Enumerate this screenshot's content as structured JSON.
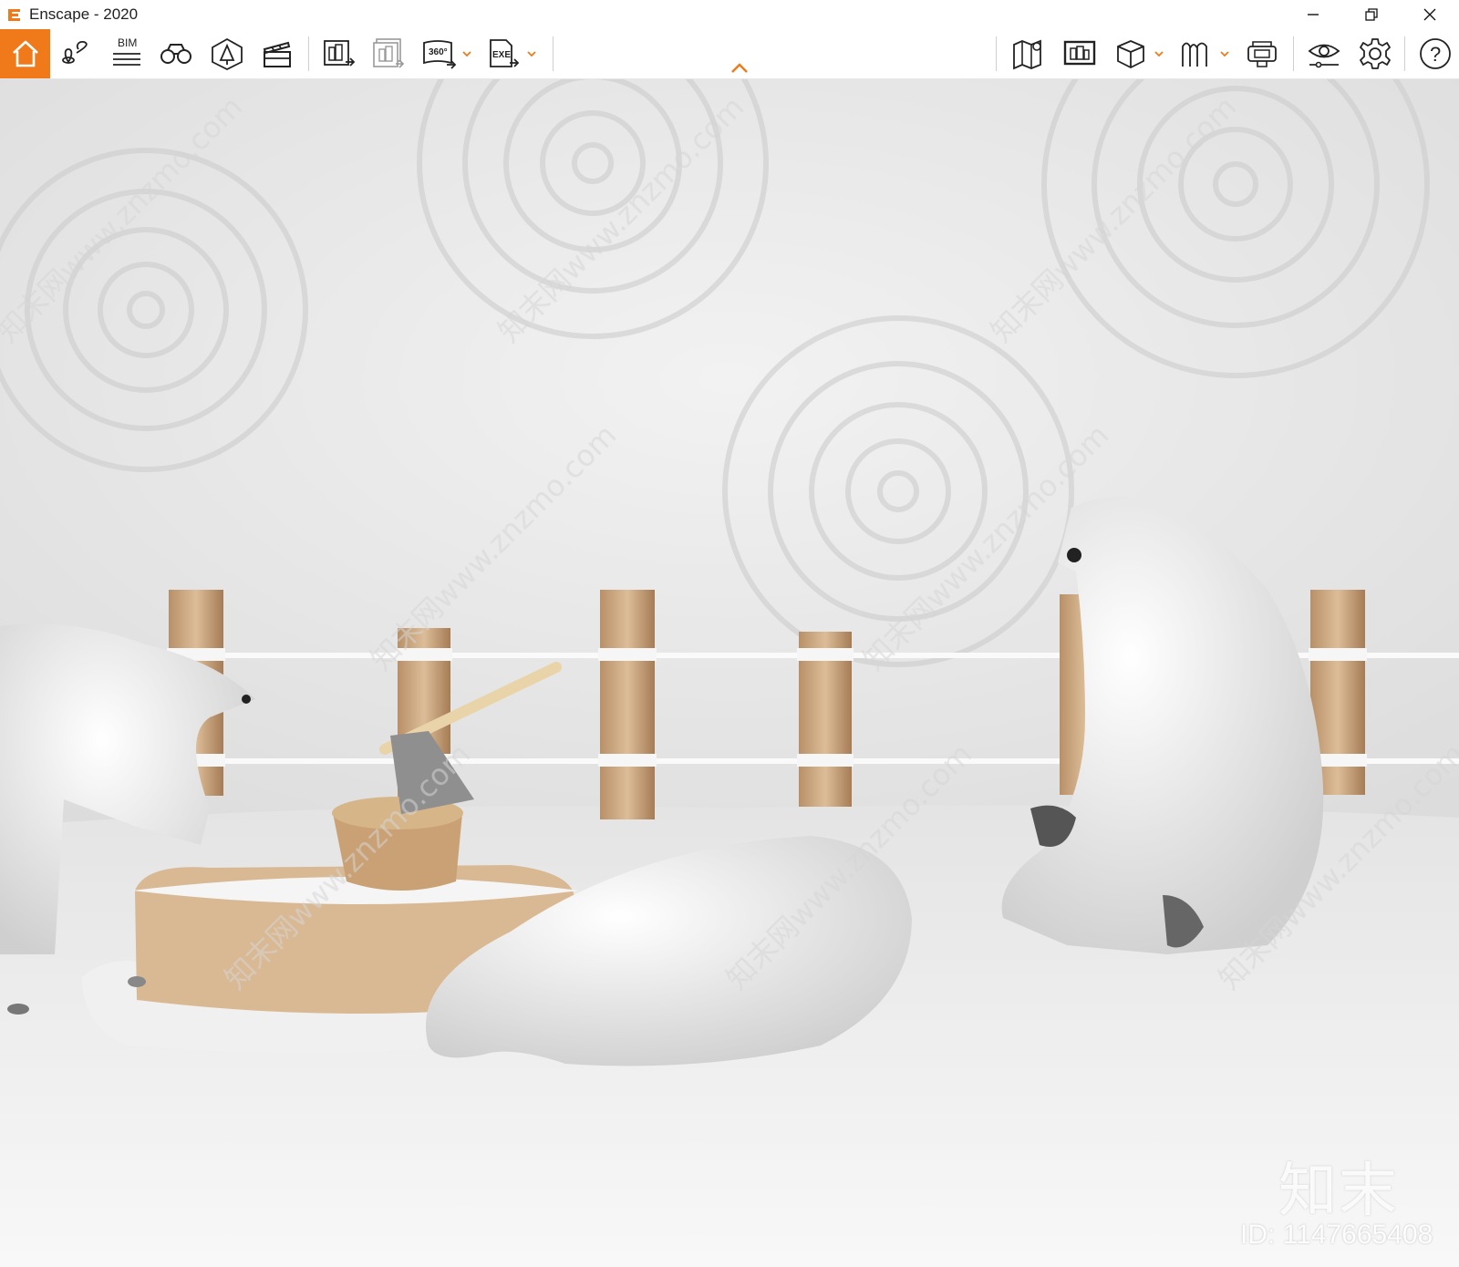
{
  "window": {
    "title": "Enscape - 2020"
  },
  "toolbar": {
    "left_icons": [
      "home-icon",
      "location-pin-icon",
      "bim-icon",
      "binoculars-icon",
      "asset-library-icon",
      "clapperboard-icon",
      "batch-render-icon",
      "render-image-icon",
      "panorama-360-icon",
      "exe-export-icon"
    ],
    "bim_label": "BIM",
    "panorama_label": "360°",
    "exe_label": "EXE",
    "right_icons": [
      "map-icon",
      "monitor-icon",
      "cube-icon",
      "vr-paths-icon",
      "vr-headset-icon",
      "eye-icon",
      "gear-icon",
      "help-icon"
    ],
    "help_label": "?"
  },
  "viewport": {
    "scene": "rendered scene: polar bears, fence posts, tree stump with axe",
    "watermark_text": "知末网www.znzmo.com"
  },
  "watermark": {
    "logo": "知末",
    "id_text": "ID: 1147665408"
  },
  "colors": {
    "accent": "#f07a1a"
  }
}
